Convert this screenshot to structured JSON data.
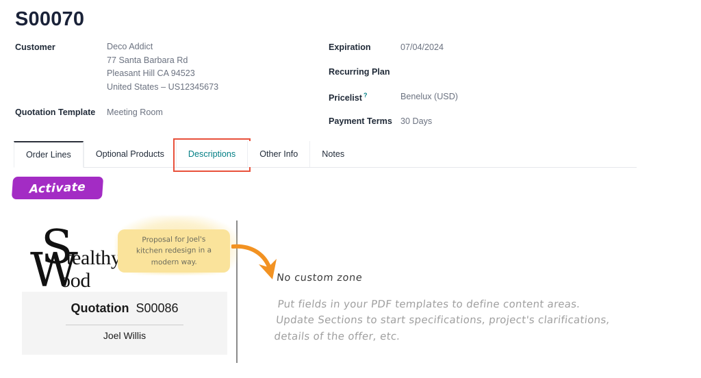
{
  "record": {
    "title": "S00070"
  },
  "customer_group": {
    "customer_label": "Customer",
    "customer_name": "Deco Addict",
    "address_line1": "77 Santa Barbara Rd",
    "address_line2": "Pleasant Hill CA 94523",
    "address_line3": "United States – US12345673",
    "quotation_template_label": "Quotation Template",
    "quotation_template_value": "Meeting Room"
  },
  "terms_group": {
    "expiration_label": "Expiration",
    "expiration_value": "07/04/2024",
    "recurring_plan_label": "Recurring Plan",
    "recurring_plan_value": "",
    "pricelist_label": "Pricelist",
    "pricelist_help": "?",
    "pricelist_value": "Benelux (USD)",
    "payment_terms_label": "Payment Terms",
    "payment_terms_value": "30 Days"
  },
  "tabs": [
    {
      "label": "Order Lines",
      "active": true,
      "highlighted": false
    },
    {
      "label": "Optional Products",
      "active": false,
      "highlighted": false
    },
    {
      "label": "Descriptions",
      "active": false,
      "highlighted": true
    },
    {
      "label": "Other Info",
      "active": false,
      "highlighted": false
    },
    {
      "label": "Notes",
      "active": false,
      "highlighted": false
    }
  ],
  "actions": {
    "activate_label": "Activate"
  },
  "document_preview": {
    "logo": {
      "big_s": "S",
      "big_w": "W",
      "tail_tealthy": "tealthy",
      "tail_ood": "ood",
      "full_name": "Stealthy Wood"
    },
    "quotation": {
      "heading": "Quotation",
      "number": "S00086",
      "person": "Joel Willis"
    },
    "sticky_note": {
      "text": "Proposal for Joel's\nkitchen redesign in a\nmodern way.",
      "tail": "❯"
    },
    "custom_zone": {
      "heading": "No custom zone",
      "body": "Put fields in your PDF templates to define content areas.\nUpdate Sections to start specifications, project's clarifications,\ndetails of the offer, etc."
    }
  },
  "colors": {
    "title": "#1a2238",
    "label": "#1f2937",
    "value": "#6b7280",
    "tab_link": "#017e84",
    "highlight_box": "#e8503a",
    "activate_button": "#a32cc4",
    "sticky_note": "#fae39b",
    "arrow": "#f29222",
    "quotation_panel": "#f4f4f4",
    "divider": "#8a8a8a",
    "handwriting_body": "#a0a0a0"
  }
}
